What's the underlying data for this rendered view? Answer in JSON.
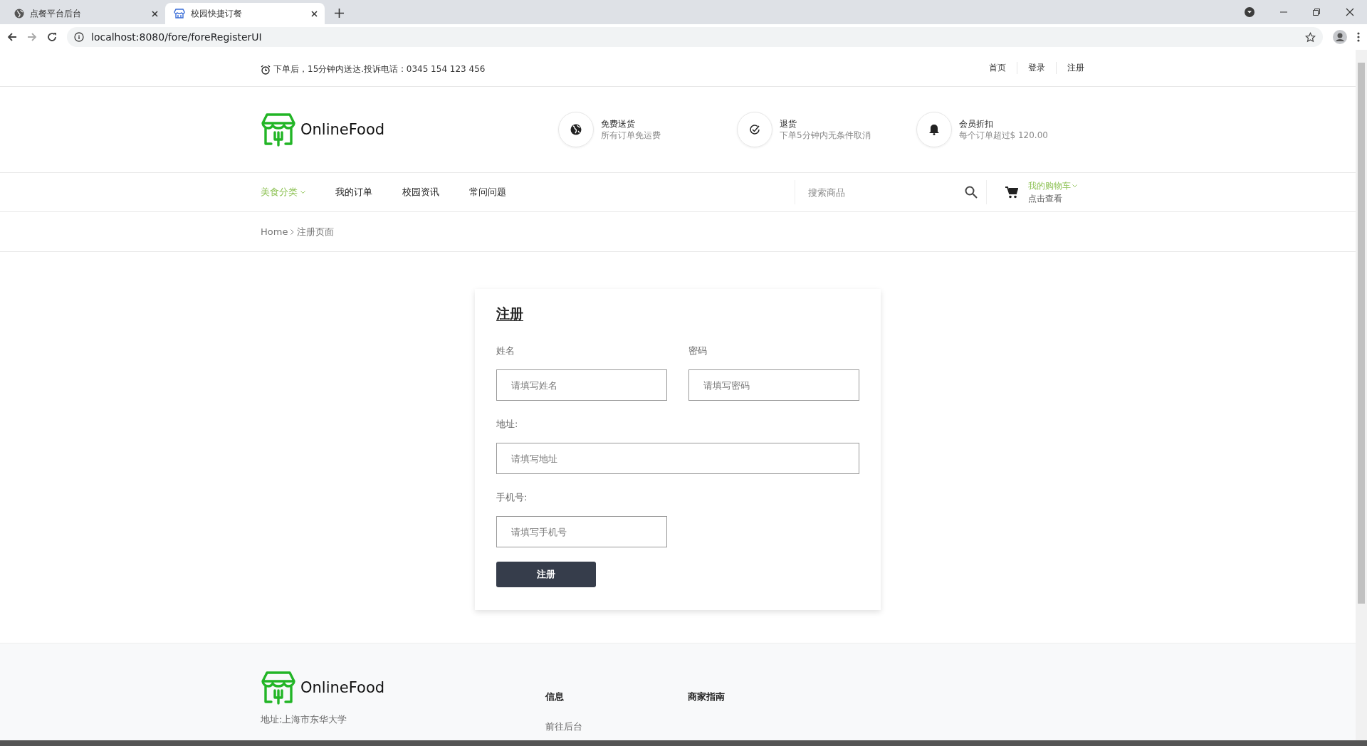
{
  "browser": {
    "tabs": [
      {
        "title": "点餐平台后台",
        "selected": false
      },
      {
        "title": "校园快捷订餐",
        "selected": true
      }
    ],
    "url": "localhost:8080/fore/foreRegisterUI"
  },
  "topbar": {
    "notice": "下单后，15分钟内送达.投诉电话 : 0345 154 123 456",
    "links": [
      "首页",
      "登录",
      "注册"
    ]
  },
  "header": {
    "logo": "OnlineFood",
    "features": [
      {
        "kind": "globe",
        "title": "免费送货",
        "text": "所有订单免运费"
      },
      {
        "kind": "check",
        "title": "退货",
        "text": "下单5分钟内无条件取消"
      },
      {
        "kind": "bell",
        "title": "会员折扣",
        "text": "每个订单超过$ 120.00"
      }
    ]
  },
  "nav": {
    "items": [
      {
        "label": "美食分类",
        "selected": true,
        "dropdown": true
      },
      {
        "label": "我的订单",
        "selected": false,
        "dropdown": false
      },
      {
        "label": "校园资讯",
        "selected": false,
        "dropdown": false
      },
      {
        "label": "常问问题",
        "selected": false,
        "dropdown": false
      }
    ],
    "search": {
      "placeholder": "搜索商品"
    },
    "cart": {
      "title": "我的购物车",
      "subtitle": "点击查看"
    }
  },
  "breadcrumb": [
    "Home",
    "注册页面"
  ],
  "form": {
    "title": "注册",
    "fields": [
      {
        "label": "姓名",
        "placeholder": "请填写姓名"
      },
      {
        "label": "密码",
        "placeholder": "请填写密码"
      },
      {
        "label": "地址:",
        "placeholder": "请填写地址"
      },
      {
        "label": "手机号:",
        "placeholder": "请填写手机号"
      }
    ],
    "submit": "注册"
  },
  "footer": {
    "logo": "OnlineFood",
    "address": "地址:上海市东华大学",
    "columns": [
      {
        "title": "信息",
        "links": [
          "前往后台"
        ]
      },
      {
        "title": "商家指南"
      }
    ]
  }
}
